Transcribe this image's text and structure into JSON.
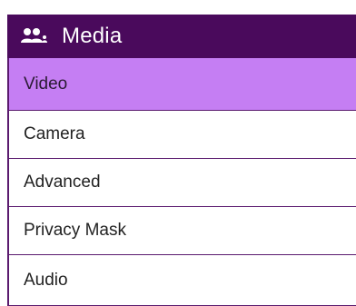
{
  "menu": {
    "title": "Media",
    "header_icon": "users-icon",
    "items": [
      {
        "label": "Video",
        "active": true
      },
      {
        "label": "Camera",
        "active": false
      },
      {
        "label": "Advanced",
        "active": false
      },
      {
        "label": "Privacy Mask",
        "active": false
      },
      {
        "label": "Audio",
        "active": false
      }
    ]
  },
  "colors": {
    "header_bg": "#4a0a5c",
    "active_bg": "#c57ef3",
    "border": "#5a1a6e"
  }
}
